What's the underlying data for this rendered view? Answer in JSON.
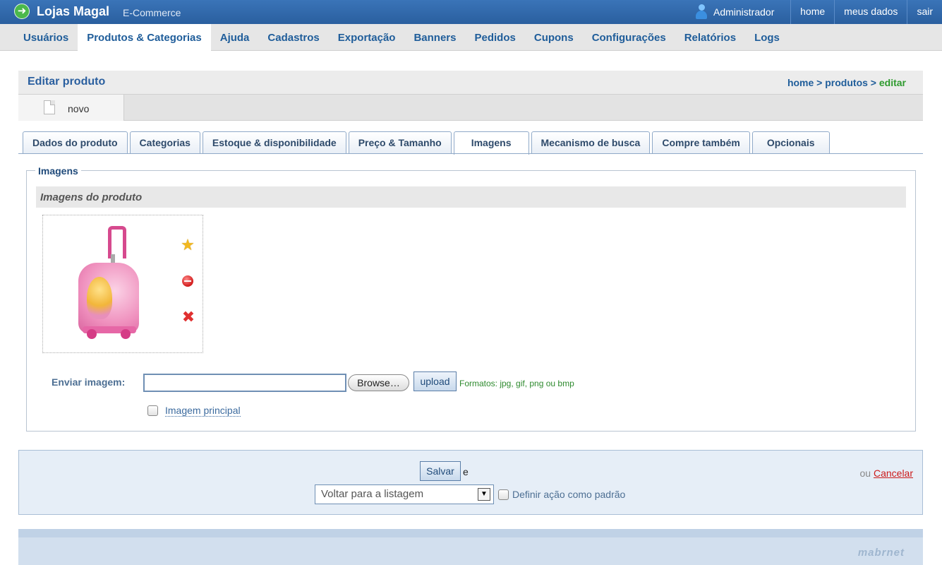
{
  "app": {
    "name": "Lojas Magal",
    "subtitle": "E-Commerce"
  },
  "topbar": {
    "user": "Administrador",
    "links": [
      "home",
      "meus dados",
      "sair"
    ]
  },
  "nav": {
    "items": [
      "Usuários",
      "Produtos & Categorias",
      "Ajuda",
      "Cadastros",
      "Exportação",
      "Banners",
      "Pedidos",
      "Cupons",
      "Configurações",
      "Relatórios",
      "Logs"
    ],
    "active": "Produtos & Categorias"
  },
  "page": {
    "title": "Editar produto",
    "breadcrumb": {
      "home": "home",
      "sep": ">",
      "produtos": "produtos",
      "current": "editar"
    }
  },
  "toolbar": {
    "new_label": "novo"
  },
  "tabs": {
    "items": [
      "Dados do produto",
      "Categorias",
      "Estoque & disponibilidade",
      "Preço & Tamanho",
      "Imagens",
      "Mecanismo de busca",
      "Compre também",
      "Opcionais"
    ],
    "active": "Imagens"
  },
  "images": {
    "legend": "Imagens",
    "section_title": "Imagens do produto",
    "send_label": "Enviar imagem:",
    "file_value": "",
    "browse_label": "Browse…",
    "upload_label": "upload",
    "formats": "Formatos: jpg, gif, png ou bmp",
    "principal_label": "Imagem principal",
    "principal_checked": false
  },
  "actions": {
    "save_label": "Salvar",
    "and_text": "e",
    "or_text": "ou",
    "cancel_label": "Cancelar",
    "after_save_selected": "Voltar para a listagem",
    "default_label": "Definir ação como padrão",
    "default_checked": false
  },
  "footer": {
    "logo": "mabrnet"
  },
  "colors": {
    "topbar": "#2a5f9f",
    "nav_text": "#1f5d9a",
    "breadcrumb_current": "#2e9a2e",
    "cancel": "#cc1a1a"
  }
}
